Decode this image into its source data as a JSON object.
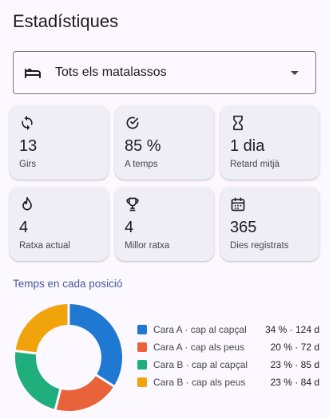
{
  "header": {
    "title": "Estadístiques"
  },
  "mattress_select": {
    "selected": "Tots els matalassos",
    "icon": "bed-icon"
  },
  "stats": [
    {
      "icon": "rotate-icon",
      "value": "13",
      "label": "Girs"
    },
    {
      "icon": "check-circle-icon",
      "value": "85 %",
      "label": "A temps"
    },
    {
      "icon": "hourglass-icon",
      "value": "1 dia",
      "label": "Retard mitjà"
    },
    {
      "icon": "flame-icon",
      "value": "4",
      "label": "Ratxa actual"
    },
    {
      "icon": "trophy-icon",
      "value": "4",
      "label": "Millor ratxa"
    },
    {
      "icon": "calendar-icon",
      "value": "365",
      "label": "Dies registrats"
    }
  ],
  "position_section": {
    "title": "Temps en cada posició"
  },
  "chart_data": {
    "type": "pie",
    "title": "Temps en cada posició",
    "series": [
      {
        "name": "Cara A · cap al capçal",
        "value": 34,
        "value_label": "34 % · 124 d",
        "color": "#1f78d1"
      },
      {
        "name": "Cara A · cap als peus",
        "value": 20,
        "value_label": "20 % · 72 d",
        "color": "#e8633a"
      },
      {
        "name": "Cara B · cap al capçal",
        "value": 23,
        "value_label": "23 % · 85 d",
        "color": "#1fae7c"
      },
      {
        "name": "Cara B · cap als peus",
        "value": 23,
        "value_label": "23 % · 84 d",
        "color": "#f0a30a"
      }
    ],
    "legend": "right"
  }
}
